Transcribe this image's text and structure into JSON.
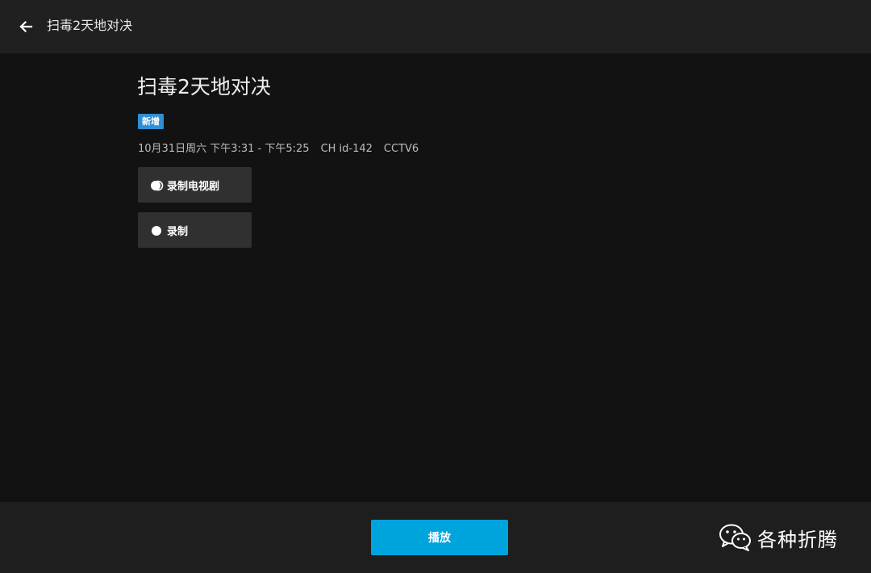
{
  "header": {
    "back_icon": "arrow-left-icon",
    "title": "扫毒2天地对决"
  },
  "program": {
    "title": "扫毒2天地对决",
    "badge": "新增",
    "badge_color": "#2f8fd6",
    "datetime": "10月31日周六 下午3:31 - 下午5:25",
    "channel_number": "CH id-142",
    "channel_name": "CCTV6"
  },
  "actions": {
    "record_series_label": "录制电视剧",
    "record_series_icon": "record-series-icon",
    "record_label": "录制",
    "record_icon": "record-icon"
  },
  "footer": {
    "play_label": "播放",
    "play_color": "#00a4dc"
  },
  "watermark": {
    "icon": "wechat-icon",
    "text": "各种折腾"
  }
}
